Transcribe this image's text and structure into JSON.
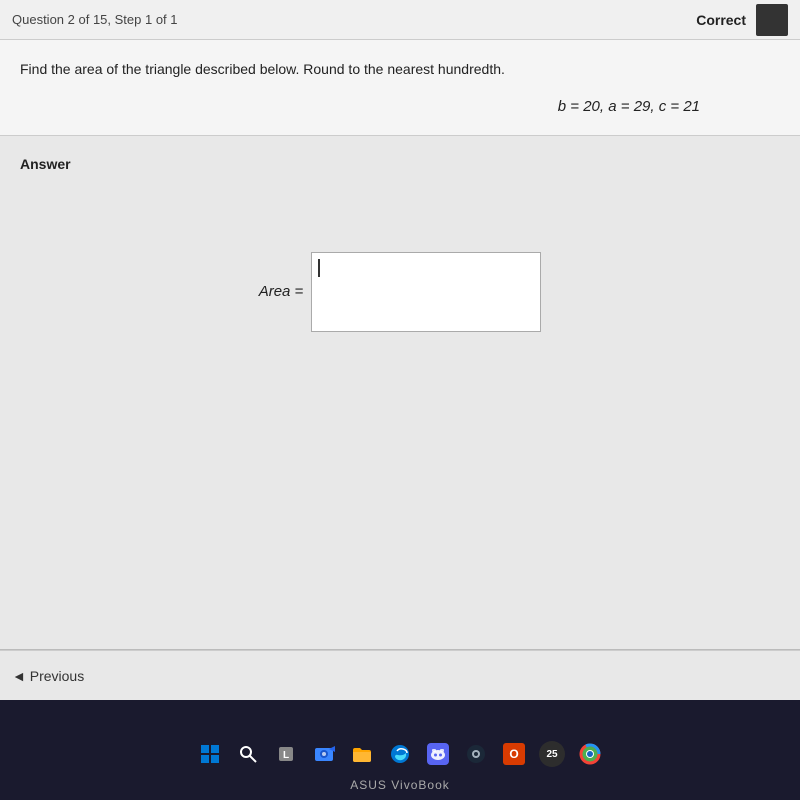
{
  "header": {
    "title": "Question 2 of 15, Step 1 of 1",
    "correct_label": "Correct"
  },
  "question": {
    "instruction": "Find the area of the triangle described below. Round to the nearest hundredth.",
    "equation": "b = 20, a = 29, c = 21"
  },
  "answer": {
    "label": "Answer",
    "area_label": "Area =",
    "input_value": ""
  },
  "navigation": {
    "previous_label": "◄ Previous"
  },
  "taskbar": {
    "brand": "ASUS VivoBook",
    "badge_number": "25",
    "icons": [
      "⊞",
      "🔍",
      "L",
      "📷",
      "📁",
      "🌐",
      "💬",
      "🎮",
      "O",
      "25",
      "●"
    ]
  }
}
